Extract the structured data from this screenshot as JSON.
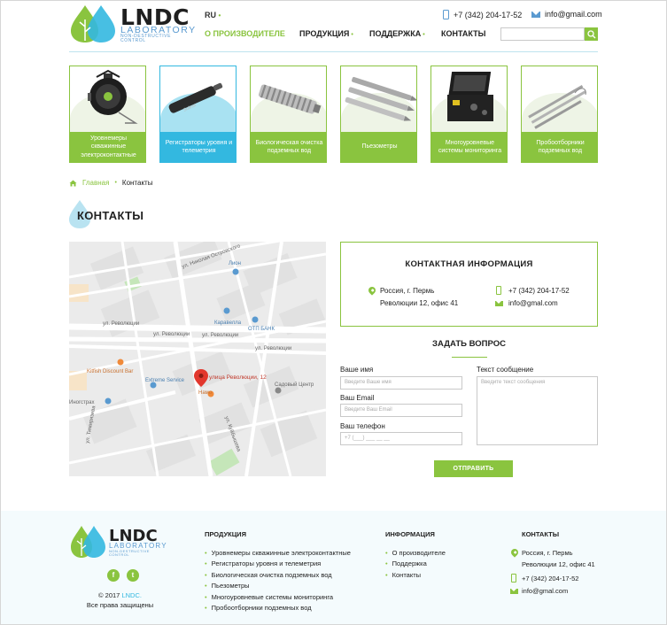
{
  "header": {
    "logo_text": "LNDC",
    "logo_sub": "LABORATORY",
    "logo_sub2": "NON-DESTRUCTIVE CONTROL",
    "lang": "RU",
    "phone": "+7 (342) 204-17-52",
    "email": "info@gmail.com",
    "nav": [
      {
        "label": "О ПРОИЗВОДИТЕЛЕ",
        "active": true,
        "dropdown": false
      },
      {
        "label": "ПРОДУКЦИЯ",
        "active": false,
        "dropdown": true
      },
      {
        "label": "ПОДДЕРЖКА",
        "active": false,
        "dropdown": true
      },
      {
        "label": "КОНТАКТЫ",
        "active": false,
        "dropdown": false
      }
    ]
  },
  "products": [
    {
      "label": "Уровнемеры скважинные электроконтактные",
      "active": false,
      "icon": "reel-icon"
    },
    {
      "label": "Регистраторы уровня и телеметрия",
      "active": true,
      "icon": "logger-icon"
    },
    {
      "label": "Биологическая очистка подземных вод",
      "active": false,
      "icon": "filter-icon"
    },
    {
      "label": "Пьезометры",
      "active": false,
      "icon": "piezometer-icon"
    },
    {
      "label": "Многоуровневые системы мониторинга",
      "active": false,
      "icon": "case-icon"
    },
    {
      "label": "Пробоотборники подземных вод",
      "active": false,
      "icon": "sampler-icon"
    }
  ],
  "breadcrumb": {
    "home": "Главная",
    "current": "Контакты"
  },
  "page_title": "КОНТАКТЫ",
  "map": {
    "streets": [
      "ул. Революции",
      "ул. Революции",
      "ул. Революции",
      "ул. Революции",
      "ул. Тимирязева",
      "ул. Николая Островского",
      "ул. Куйбышева"
    ],
    "places": [
      "Лион",
      "Каравелла",
      "ОТП БАНК",
      "Kitfish Discount Bar",
      "Extreme Service",
      "Намо",
      "Садовый Центр",
      "Иногстрах"
    ],
    "marker": "улица Революции, 12"
  },
  "contact_info": {
    "title": "КОНТАКТНАЯ ИНФОРМАЦИЯ",
    "address_line1": "Россия, г. Пермь",
    "address_line2": "Революции 12, офис 41",
    "phone": "+7 (342) 204-17-52",
    "email": "info@gmal.com"
  },
  "form": {
    "title": "ЗАДАТЬ ВОПРОС",
    "name_label": "Ваше имя",
    "name_placeholder": "Введите Ваше имя",
    "email_label": "Ваш Email",
    "email_placeholder": "Введите Ваш Email",
    "phone_label": "Ваш телефон",
    "phone_placeholder": "+7 (___) ___ __ __",
    "message_label": "Текст сообщение",
    "message_placeholder": "Введите текст сообщения",
    "submit": "ОТПРАВИТЬ"
  },
  "footer": {
    "logo_text": "LNDC",
    "logo_sub": "LABORATORY",
    "logo_sub2": "NON-DESTRUCTIVE CONTROL",
    "social": [
      "f",
      "t"
    ],
    "copy_prefix": "© 2017 ",
    "copy_brand": "LNDC.",
    "copy_rights": "Все права защищены",
    "products_title": "ПРОДУКЦИЯ",
    "products": [
      "Уровнемеры скважинные электроконтактные",
      "Регистраторы уровня и телеметрия",
      "Биологическая очистка подземных вод",
      "Пьезометры",
      "Многоуровневые системы мониторинга",
      "Пробоотборники подземных вод"
    ],
    "info_title": "ИНФОРМАЦИЯ",
    "info": [
      "О производителе",
      "Поддержка",
      "Контакты"
    ],
    "contacts_title": "КОНТАКТЫ",
    "address_line1": "Россия, г. Пермь",
    "address_line2": "Революции 12, офис 41",
    "phone": "+7 (342) 204-17-52",
    "email": "info@gmal.com"
  },
  "colors": {
    "green": "#8ac43f",
    "blue": "#33b8e0",
    "footer_bg": "#f4fbfd"
  }
}
